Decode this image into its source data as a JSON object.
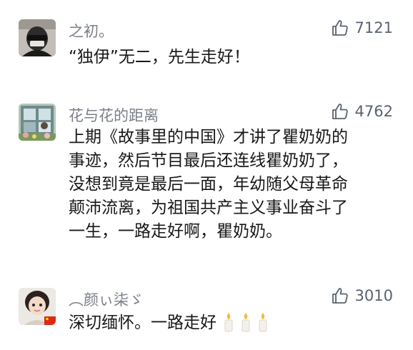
{
  "comments": [
    {
      "username": "之初。",
      "likes": "7121",
      "text_lines": [
        "“独伊”无二，先生走好！"
      ],
      "avatar_icon": "masked-person-avatar-icon"
    },
    {
      "username": "花与花的距离",
      "likes": "4762",
      "text_lines": [
        "上期《故事里的中国》才讲了瞿奶奶的",
        "事迹，然后节目最后还连线瞿奶奶了，",
        "没想到竟是最后一面，年幼随父母革命",
        "颠沛流离，为祖国共产主义事业奋斗了",
        "一生，一路走好啊，瞿奶奶。"
      ],
      "avatar_icon": "window-flowers-avatar-icon"
    },
    {
      "username": "︵颜ぃ柒ゞ",
      "likes": "3010",
      "text_lines": [
        "深切缅怀。一路走好"
      ],
      "avatar_icon": "child-portrait-avatar-icon",
      "emoji": [
        "candle-icon",
        "candle-icon",
        "candle-icon"
      ]
    }
  ],
  "colors": {
    "username": "#7b7f8a",
    "text": "#181818",
    "like": "#596270"
  }
}
